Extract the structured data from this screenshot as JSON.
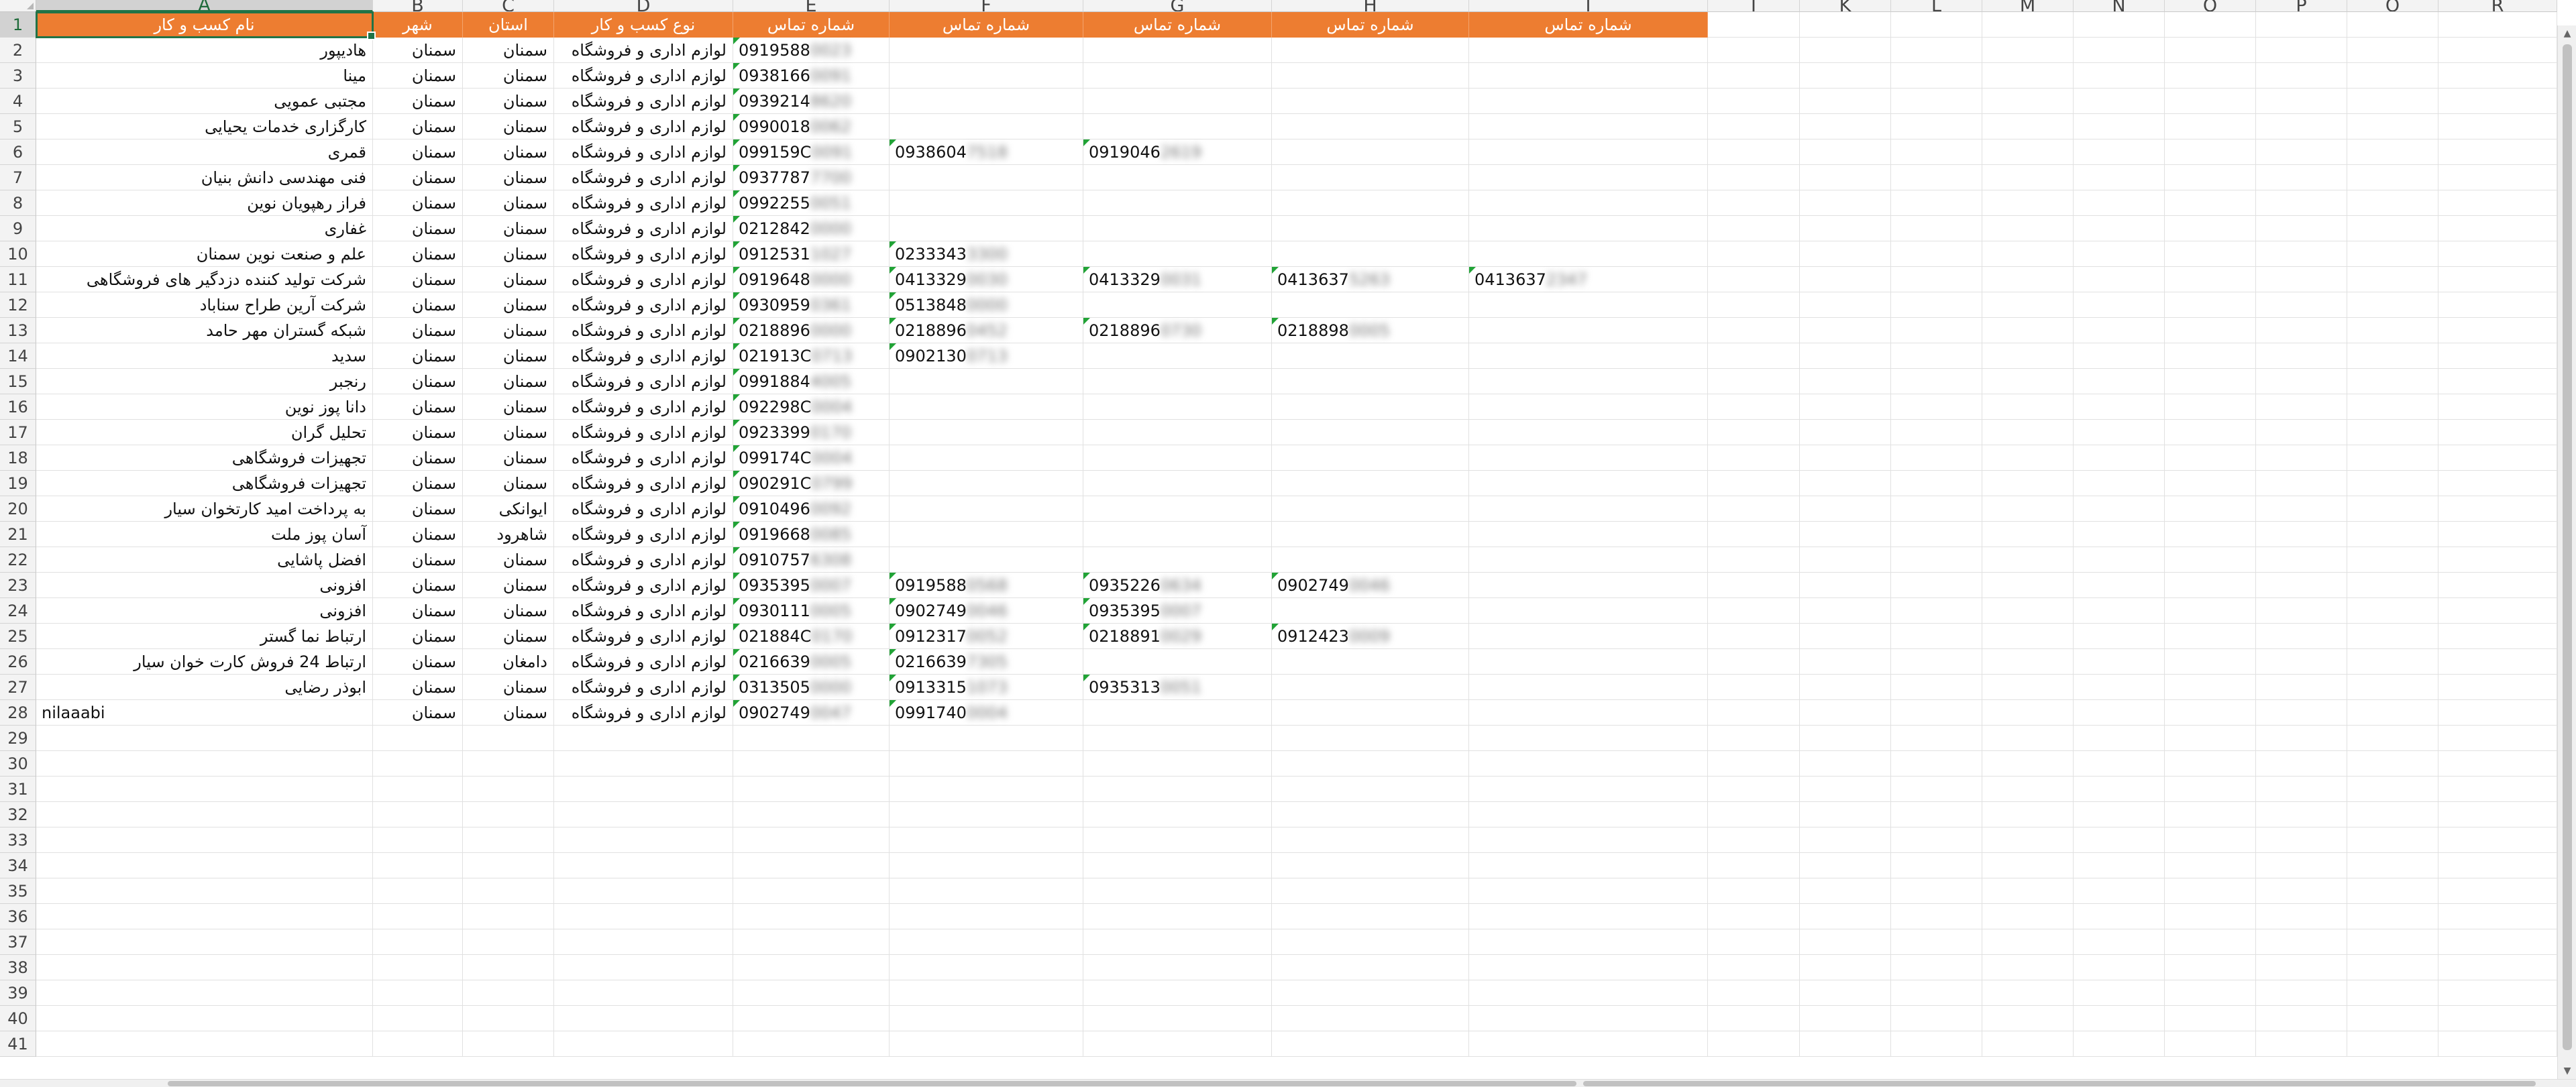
{
  "columns": [
    "A",
    "B",
    "C",
    "D",
    "E",
    "F",
    "G",
    "H",
    "I",
    "J",
    "K",
    "L",
    "M",
    "N",
    "O",
    "P",
    "Q",
    "R"
  ],
  "selected_cell": "A1",
  "header_fill": "#ed7d31",
  "header_text_color": "#ffffff",
  "error_indicator_color": "#21a336",
  "row_numbers": [
    "1",
    "2",
    "3",
    "4",
    "5",
    "6",
    "7",
    "8",
    "9",
    "10",
    "11",
    "12",
    "13",
    "14",
    "15",
    "16",
    "17",
    "18",
    "19",
    "20",
    "21",
    "22",
    "23",
    "24",
    "25",
    "26",
    "27",
    "28",
    "29",
    "30",
    "31",
    "32",
    "33",
    "34",
    "35",
    "36",
    "37",
    "38",
    "39",
    "40",
    "41"
  ],
  "header_row": [
    "نام کسب و کار",
    "شهر",
    "استان",
    "نوع کسب و کار",
    "شماره تماس",
    "شماره تماس",
    "شماره تماس",
    "شماره تماس",
    "شماره تماس"
  ],
  "rows": [
    {
      "name": "هادیپور",
      "city": "سمنان",
      "province": "سمنان",
      "type": "لوازم اداری و فروشگاه",
      "phones": [
        [
          "0919588",
          "0023"
        ]
      ]
    },
    {
      "name": "مینا",
      "city": "سمنان",
      "province": "سمنان",
      "type": "لوازم اداری و فروشگاه",
      "phones": [
        [
          "0938166",
          "0091"
        ]
      ]
    },
    {
      "name": "مجتبی عمویی",
      "city": "سمنان",
      "province": "سمنان",
      "type": "لوازم اداری و فروشگاه",
      "phones": [
        [
          "0939214",
          "8620"
        ]
      ]
    },
    {
      "name": "کارگزاری خدمات یحیایی",
      "city": "سمنان",
      "province": "سمنان",
      "type": "لوازم اداری و فروشگاه",
      "phones": [
        [
          "0990018",
          "0062"
        ]
      ]
    },
    {
      "name": "قمری",
      "city": "سمنان",
      "province": "سمنان",
      "type": "لوازم اداری و فروشگاه",
      "phones": [
        [
          "099159C",
          "0091"
        ],
        [
          "0938604",
          "7518"
        ],
        [
          "0919046",
          "2619"
        ]
      ]
    },
    {
      "name": "فنی مهندسی دانش بنیان",
      "city": "سمنان",
      "province": "سمنان",
      "type": "لوازم اداری و فروشگاه",
      "phones": [
        [
          "0937787",
          "7700"
        ]
      ]
    },
    {
      "name": "فراز رهپویان نوین",
      "city": "سمنان",
      "province": "سمنان",
      "type": "لوازم اداری و فروشگاه",
      "phones": [
        [
          "0992255",
          "0051"
        ]
      ]
    },
    {
      "name": "غفاری",
      "city": "سمنان",
      "province": "سمنان",
      "type": "لوازم اداری و فروشگاه",
      "phones": [
        [
          "0212842",
          "0000"
        ]
      ]
    },
    {
      "name": "علم و صنعت نوین سمنان",
      "city": "سمنان",
      "province": "سمنان",
      "type": "لوازم اداری و فروشگاه",
      "phones": [
        [
          "0912531",
          "1027"
        ],
        [
          "0233343",
          "3300"
        ]
      ]
    },
    {
      "name": "شرکت تولید کننده دزدگیر های فروشگاهی",
      "city": "سمنان",
      "province": "سمنان",
      "type": "لوازم اداری و فروشگاه",
      "phones": [
        [
          "0919648",
          "0000"
        ],
        [
          "0413329",
          "0030"
        ],
        [
          "0413329",
          "0031"
        ],
        [
          "0413637",
          "5263"
        ],
        [
          "0413637",
          "2347"
        ]
      ]
    },
    {
      "name": "شرکت آرین طراح سناباد",
      "city": "سمنان",
      "province": "سمنان",
      "type": "لوازم اداری و فروشگاه",
      "phones": [
        [
          "0930959",
          "0361"
        ],
        [
          "0513848",
          "0000"
        ]
      ]
    },
    {
      "name": "شبکه گستران مهر حامد",
      "city": "سمنان",
      "province": "سمنان",
      "type": "لوازم اداری و فروشگاه",
      "phones": [
        [
          "0218896",
          "0000"
        ],
        [
          "0218896",
          "0452"
        ],
        [
          "0218896",
          "0730"
        ],
        [
          "0218898",
          "0005"
        ]
      ]
    },
    {
      "name": "سدید",
      "city": "سمنان",
      "province": "سمنان",
      "type": "لوازم اداری و فروشگاه",
      "phones": [
        [
          "021913C",
          "0713"
        ],
        [
          "0902130",
          "0713"
        ]
      ]
    },
    {
      "name": "رنجبر",
      "city": "سمنان",
      "province": "سمنان",
      "type": "لوازم اداری و فروشگاه",
      "phones": [
        [
          "0991884",
          "4005"
        ]
      ]
    },
    {
      "name": "دانا پوز نوین",
      "city": "سمنان",
      "province": "سمنان",
      "type": "لوازم اداری و فروشگاه",
      "phones": [
        [
          "092298C",
          "0004"
        ]
      ]
    },
    {
      "name": "تحلیل گران",
      "city": "سمنان",
      "province": "سمنان",
      "type": "لوازم اداری و فروشگاه",
      "phones": [
        [
          "0923399",
          "0170"
        ]
      ]
    },
    {
      "name": "تجهیزات فروشگاهی",
      "city": "سمنان",
      "province": "سمنان",
      "type": "لوازم اداری و فروشگاه",
      "phones": [
        [
          "099174C",
          "0004"
        ]
      ]
    },
    {
      "name": "تجهیزات فروشگاهی",
      "city": "سمنان",
      "province": "سمنان",
      "type": "لوازم اداری و فروشگاه",
      "phones": [
        [
          "090291C",
          "0799"
        ]
      ]
    },
    {
      "name": "به پرداخت امید کارتخوان سیار",
      "city": "سمنان",
      "province": "ایوانکی",
      "type": "لوازم اداری و فروشگاه",
      "phones": [
        [
          "0910496",
          "0092"
        ]
      ]
    },
    {
      "name": "آسان پوز ملت",
      "city": "سمنان",
      "province": "شاهرود",
      "type": "لوازم اداری و فروشگاه",
      "phones": [
        [
          "0919668",
          "0085"
        ]
      ]
    },
    {
      "name": "افضل پاشایی",
      "city": "سمنان",
      "province": "سمنان",
      "type": "لوازم اداری و فروشگاه",
      "phones": [
        [
          "0910757",
          "6308"
        ]
      ]
    },
    {
      "name": "افزونی",
      "city": "سمنان",
      "province": "سمنان",
      "type": "لوازم اداری و فروشگاه",
      "phones": [
        [
          "0935395",
          "0007"
        ],
        [
          "0919588",
          "0568"
        ],
        [
          "0935226",
          "0634"
        ],
        [
          "0902749",
          "0046"
        ]
      ]
    },
    {
      "name": "افزونی",
      "city": "سمنان",
      "province": "سمنان",
      "type": "لوازم اداری و فروشگاه",
      "phones": [
        [
          "0930111",
          "0005"
        ],
        [
          "0902749",
          "0046"
        ],
        [
          "0935395",
          "0007"
        ]
      ]
    },
    {
      "name": "ارتباط نما گستر",
      "city": "سمنان",
      "province": "سمنان",
      "type": "لوازم اداری و فروشگاه",
      "phones": [
        [
          "021884C",
          "0170"
        ],
        [
          "0912317",
          "0052"
        ],
        [
          "0218891",
          "0029"
        ],
        [
          "0912423",
          "0009"
        ]
      ]
    },
    {
      "name": "ارتباط 24 فروش کارت خوان سیار",
      "city": "سمنان",
      "province": "دامغان",
      "type": "لوازم اداری و فروشگاه",
      "phones": [
        [
          "0216639",
          "0005"
        ],
        [
          "0216639",
          "7305"
        ]
      ]
    },
    {
      "name": "ابوذر رضایی",
      "city": "سمنان",
      "province": "سمنان",
      "type": "لوازم اداری و فروشگاه",
      "phones": [
        [
          "0313505",
          "0000"
        ],
        [
          "0913315",
          "1073"
        ],
        [
          "0935313",
          "0051"
        ]
      ]
    },
    {
      "name": "nilaaabi",
      "city": "سمنان",
      "province": "سمنان",
      "type": "لوازم اداری و فروشگاه",
      "phones": [
        [
          "0902749",
          "0047"
        ],
        [
          "0991740",
          "0004"
        ]
      ]
    }
  ]
}
